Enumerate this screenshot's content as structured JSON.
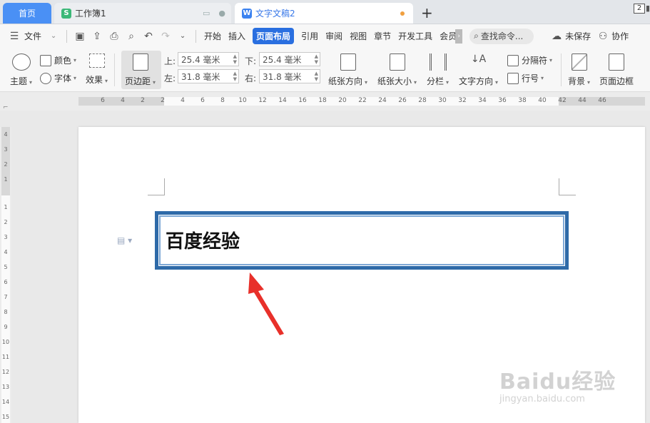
{
  "tabs": {
    "home": "首页",
    "sheet": "工作簿1",
    "doc": "文字文稿2",
    "sheet_icon": "S",
    "doc_icon": "W",
    "window_count": "2"
  },
  "menu": {
    "file": "文件",
    "items": [
      "开始",
      "插入",
      "页面布局",
      "引用",
      "审阅",
      "视图",
      "章节",
      "开发工具",
      "会员"
    ],
    "active_index": 2,
    "search_placeholder": "查找命令...",
    "unsaved": "未保存",
    "share": "协作"
  },
  "ribbon": {
    "theme": "主题",
    "color": "颜色",
    "font": "字体",
    "effect": "效果",
    "margins": "页边距",
    "top_label": "上:",
    "bottom_label": "下:",
    "left_label": "左:",
    "right_label": "右:",
    "top": "25.4 毫米",
    "bottom": "25.4 毫米",
    "left": "31.8 毫米",
    "right": "31.8 毫米",
    "orientation": "纸张方向",
    "size": "纸张大小",
    "columns": "分栏",
    "text_direction": "文字方向",
    "breaks": "分隔符",
    "line_numbers": "行号",
    "background": "背景",
    "page_border": "页面边框"
  },
  "ruler": {
    "h_ticks": [
      "6",
      "4",
      "2",
      "2",
      "4",
      "6",
      "8",
      "10",
      "12",
      "14",
      "16",
      "18",
      "20",
      "22",
      "24",
      "26",
      "28",
      "30",
      "32",
      "34",
      "36",
      "38",
      "40",
      "42",
      "44",
      "46"
    ],
    "v_ticks_top": [
      "4",
      "3",
      "2",
      "1"
    ],
    "v_ticks_body": [
      "1",
      "2",
      "3",
      "4",
      "5",
      "6",
      "7",
      "8",
      "9",
      "10",
      "11",
      "12",
      "13",
      "14",
      "15"
    ]
  },
  "document": {
    "textbox_text": "百度经验"
  },
  "watermark": {
    "main": "Baidu经验",
    "sub": "jingyan.baidu.com"
  },
  "colors": {
    "accent": "#2a6fe0",
    "textbox_border": "#2e6aa8",
    "arrow": "#e8302a"
  }
}
